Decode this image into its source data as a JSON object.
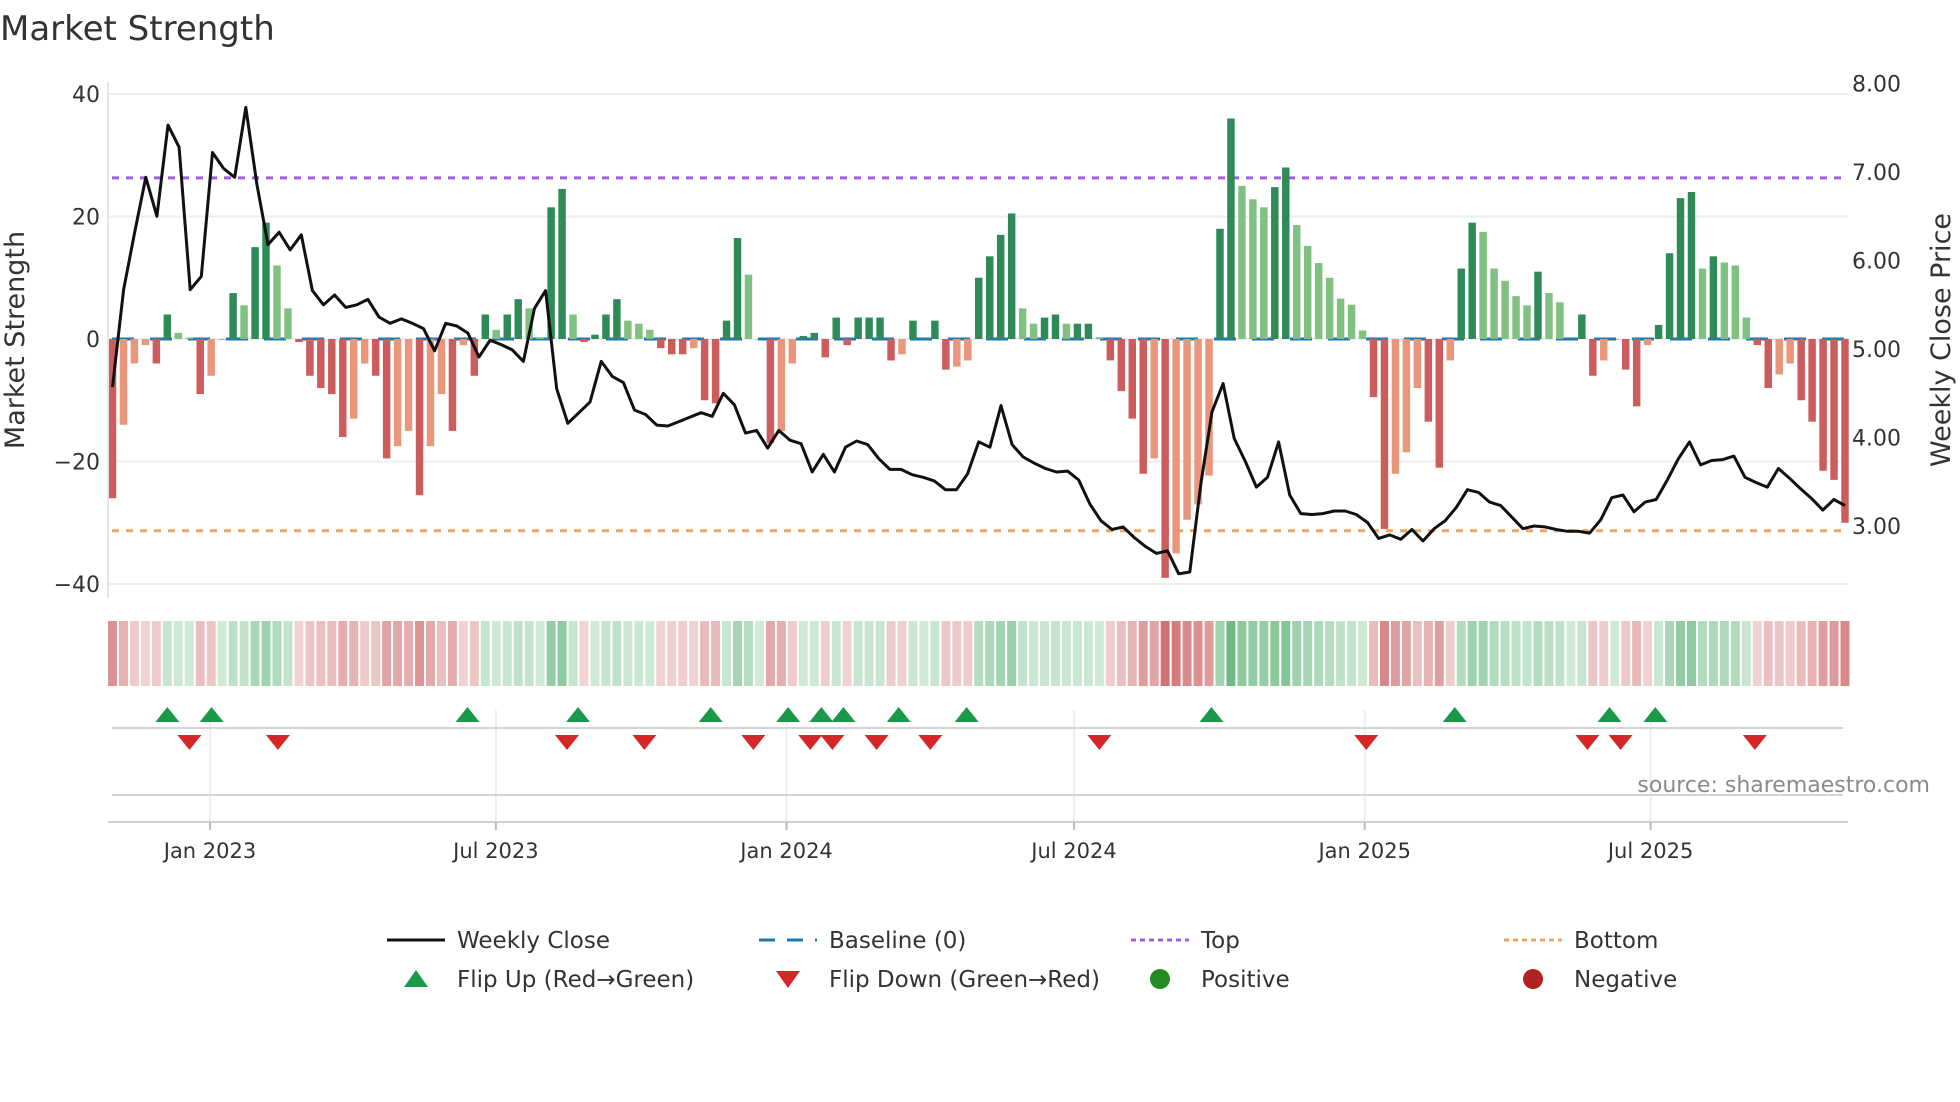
{
  "chart_data": {
    "type": "bar+line",
    "title": "Market Strength",
    "ylabel": "Market Strength",
    "y2label": "Weekly Close Price",
    "ylim": [
      -40,
      40
    ],
    "y2lim": [
      2.5,
      8.0
    ],
    "yticks": [
      "40",
      "20",
      "0",
      "−20",
      "−40"
    ],
    "ytick_values": [
      40,
      20,
      0,
      -20,
      -40
    ],
    "y2ticks": [
      "8.00",
      "7.00",
      "6.00",
      "5.00",
      "4.00",
      "3.00"
    ],
    "y2tick_values": [
      8,
      7,
      6,
      5,
      4,
      3
    ],
    "xticks": [
      {
        "label": "Jan 2023",
        "date": "2023-01-01"
      },
      {
        "label": "Jul 2023",
        "date": "2023-07-01"
      },
      {
        "label": "Jan 2024",
        "date": "2024-01-01"
      },
      {
        "label": "Jul 2024",
        "date": "2024-07-01"
      },
      {
        "label": "Jan 2025",
        "date": "2025-01-01"
      },
      {
        "label": "Jul 2025",
        "date": "2025-07-01"
      }
    ],
    "frequency": "weekly",
    "start_date": "2022-10-31",
    "end_date": "2025-10-20",
    "top_level": 26.3,
    "bottom_level": -31.3,
    "baseline": 0,
    "strength": [
      -26,
      -14,
      -4,
      -1,
      -4,
      4,
      1,
      0.2,
      -9,
      -6,
      0,
      7.5,
      5.5,
      15,
      19,
      12,
      5,
      -0.5,
      -6,
      -8,
      -9,
      -16,
      -13,
      -4,
      -6,
      -19.5,
      -17.5,
      -15,
      -25.5,
      -17.5,
      -9,
      -15,
      -1,
      -6,
      4,
      1.5,
      4,
      6.5,
      5,
      0.3,
      21.5,
      24.5,
      4,
      -0.5,
      0.7,
      4,
      6.5,
      3,
      2.5,
      1.5,
      -1.5,
      -2.5,
      -2.5,
      -1.5,
      -10,
      -10.5,
      3,
      16.5,
      10.5,
      0,
      -17,
      -15,
      -4,
      0.5,
      1,
      -3,
      3.5,
      -1,
      3.5,
      3.5,
      3.5,
      -3.5,
      -2.5,
      3,
      0,
      3,
      -5,
      -4.5,
      -3.5,
      10,
      13.5,
      17,
      20.5,
      5,
      2.5,
      3.5,
      4,
      2.5,
      2.5,
      2.5,
      0.3,
      -3.5,
      -8.5,
      -13,
      -22,
      -19.5,
      -39,
      -35,
      -29.5,
      -27,
      -22.3,
      18,
      36,
      25,
      22.8,
      21.5,
      24.8,
      28,
      18.6,
      15.2,
      12.4,
      10,
      6.6,
      5.6,
      1.4,
      -9.5,
      -31,
      -22,
      -18.5,
      -8,
      -13.5,
      -21,
      -3.5,
      11.5,
      19,
      17.5,
      11.5,
      9.5,
      7,
      5.5,
      11,
      7.5,
      6,
      0,
      4,
      -6,
      -3.5,
      0,
      -5,
      -11,
      -1,
      2.3,
      14,
      23,
      24,
      11.5,
      13.5,
      12.5,
      12,
      3.5,
      -1,
      -8,
      -5.8,
      -4,
      -10,
      -13.5,
      -21.5,
      -23,
      -30
    ],
    "weekly_close": [
      4.57,
      5.67,
      6.32,
      6.94,
      6.5,
      7.53,
      7.28,
      5.67,
      5.82,
      7.22,
      7.04,
      6.94,
      7.73,
      6.86,
      6.18,
      6.32,
      6.12,
      6.29,
      5.66,
      5.5,
      5.61,
      5.47,
      5.5,
      5.56,
      5.36,
      5.29,
      5.34,
      5.29,
      5.23,
      4.98,
      5.29,
      5.26,
      5.18,
      4.91,
      5.1,
      5.05,
      4.99,
      4.86,
      5.46,
      5.66,
      4.55,
      4.16,
      4.28,
      4.4,
      4.86,
      4.69,
      4.62,
      4.31,
      4.26,
      4.14,
      4.13,
      4.18,
      4.23,
      4.28,
      4.24,
      4.5,
      4.37,
      4.05,
      4.08,
      3.88,
      4.08,
      3.97,
      3.93,
      3.61,
      3.81,
      3.61,
      3.89,
      3.96,
      3.92,
      3.76,
      3.64,
      3.64,
      3.58,
      3.55,
      3.51,
      3.41,
      3.41,
      3.59,
      3.95,
      3.89,
      4.36,
      3.92,
      3.78,
      3.71,
      3.65,
      3.61,
      3.62,
      3.52,
      3.25,
      3.06,
      2.96,
      2.99,
      2.87,
      2.77,
      2.69,
      2.72,
      2.46,
      2.48,
      3.48,
      4.29,
      4.61,
      3.99,
      3.73,
      3.44,
      3.55,
      3.95,
      3.35,
      3.14,
      3.13,
      3.14,
      3.17,
      3.17,
      3.13,
      3.04,
      2.86,
      2.9,
      2.85,
      2.96,
      2.83,
      2.97,
      3.06,
      3.21,
      3.41,
      3.38,
      3.27,
      3.23,
      3.1,
      2.97,
      3.0,
      2.99,
      2.96,
      2.94,
      2.94,
      2.92,
      3.07,
      3.32,
      3.35,
      3.16,
      3.27,
      3.3,
      3.52,
      3.76,
      3.95,
      3.69,
      3.74,
      3.75,
      3.79,
      3.55,
      3.49,
      3.44,
      3.65,
      3.54,
      3.42,
      3.31,
      3.18,
      3.3,
      3.23
    ],
    "flip_up_dates": [
      "2022-12-05",
      "2023-01-02",
      "2023-06-13",
      "2023-08-22",
      "2023-11-14",
      "2024-01-02",
      "2024-01-23",
      "2024-02-06",
      "2024-03-12",
      "2024-04-24",
      "2024-09-26",
      "2025-02-27",
      "2025-06-05",
      "2025-07-04"
    ],
    "flip_down_dates": [
      "2022-12-19",
      "2023-02-13",
      "2023-08-15",
      "2023-10-03",
      "2023-12-11",
      "2024-01-16",
      "2024-01-30",
      "2024-02-27",
      "2024-04-01",
      "2024-07-17",
      "2025-01-02",
      "2025-05-22",
      "2025-06-12",
      "2025-09-05"
    ],
    "legend_position": "bottom",
    "legend": [
      {
        "key": "weekly_close",
        "label": "Weekly Close"
      },
      {
        "key": "baseline",
        "label": "Baseline (0)"
      },
      {
        "key": "top",
        "label": "Top"
      },
      {
        "key": "bottom",
        "label": "Bottom"
      },
      {
        "key": "flip_up",
        "label": "Flip Up (Red→Green)"
      },
      {
        "key": "flip_down",
        "label": "Flip Down (Green→Red)"
      },
      {
        "key": "positive",
        "label": "Positive"
      },
      {
        "key": "negative",
        "label": "Negative"
      }
    ],
    "source": "source: sharemaestro.com",
    "colors": {
      "pos_strong": "#2e8b57",
      "pos_weak": "#80c080",
      "neg_strong": "#cd5c5c",
      "neg_weak": "#e9967a",
      "line": "#111111",
      "baseline": "#1f77b4",
      "top": "#9d5fe0",
      "bottom": "#f4a460",
      "flip_up": "#1a9a48",
      "flip_down": "#d62728",
      "positive": "#228b22",
      "negative": "#b22222"
    }
  }
}
